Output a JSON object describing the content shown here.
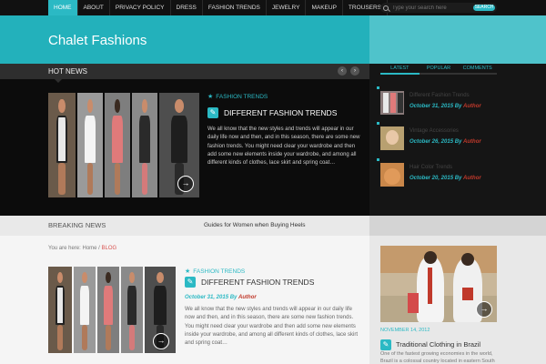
{
  "nav": {
    "items": [
      "HOME",
      "ABOUT",
      "PRIVACY POLICY",
      "DRESS",
      "FASHION TRENDS",
      "JEWELRY",
      "MAKEUP",
      "TROUSERS"
    ],
    "active": "HOME"
  },
  "search": {
    "placeholder": "Type your search here",
    "button": "SEARCH"
  },
  "site": {
    "title": "Chalet Fashions"
  },
  "hot_news": {
    "label": "HOT NEWS",
    "prev_icon": "chevron-left-icon",
    "next_icon": "chevron-right-icon",
    "category": "FASHION TRENDS",
    "title": "DIFFERENT FASHION TRENDS",
    "excerpt": "We all know that the new styles and trends will appear in our daily life now and then, and in this season, there are some new fashion trends. You might need clear your wardrobe and then add some new elements inside your wardrobe, and among all different kinds of clothes, lace skirt and spring coat…"
  },
  "sidebar_tabs": [
    "LATEST",
    "POPULAR",
    "COMMENTS"
  ],
  "sidebar_posts": [
    {
      "title": "Different Fashion Trends",
      "date": "October 31, 2015",
      "by": "By",
      "author": "Author"
    },
    {
      "title": "Vintage Accessories",
      "date": "October 26, 2015",
      "by": "By",
      "author": "Author"
    },
    {
      "title": "Hair Color Trends",
      "date": "October 20, 2015",
      "by": "By",
      "author": "Author"
    }
  ],
  "breaking": {
    "label": "BREAKING NEWS",
    "ticker": "Guides for Women when Buying Heels"
  },
  "breadcrumb": {
    "prefix": "You are here: ",
    "home": "Home",
    "sep": " / ",
    "current": "BLOG"
  },
  "post": {
    "category": "FASHION TRENDS",
    "title": "DIFFERENT FASHION TRENDS",
    "date": "October 31, 2015",
    "by": "By",
    "author": "Author",
    "excerpt": "We all know that the new styles and trends will appear in our daily life now and then, and in this season, there are some new fashion trends. You might need clear your wardrobe and then add some new elements inside your wardrobe, and among all different kinds of clothes, lace skirt and spring coat…"
  },
  "side_feature": {
    "date": "NOVEMBER 14, 2012",
    "title": "Traditional Clothing in Brazil",
    "excerpt": "One of the fastest growing economies in the world, Brazil is a colossal country located in eastern South"
  },
  "colors": {
    "accent": "#2bb9c4",
    "header": "#23b1bb",
    "author": "#c0392b"
  }
}
